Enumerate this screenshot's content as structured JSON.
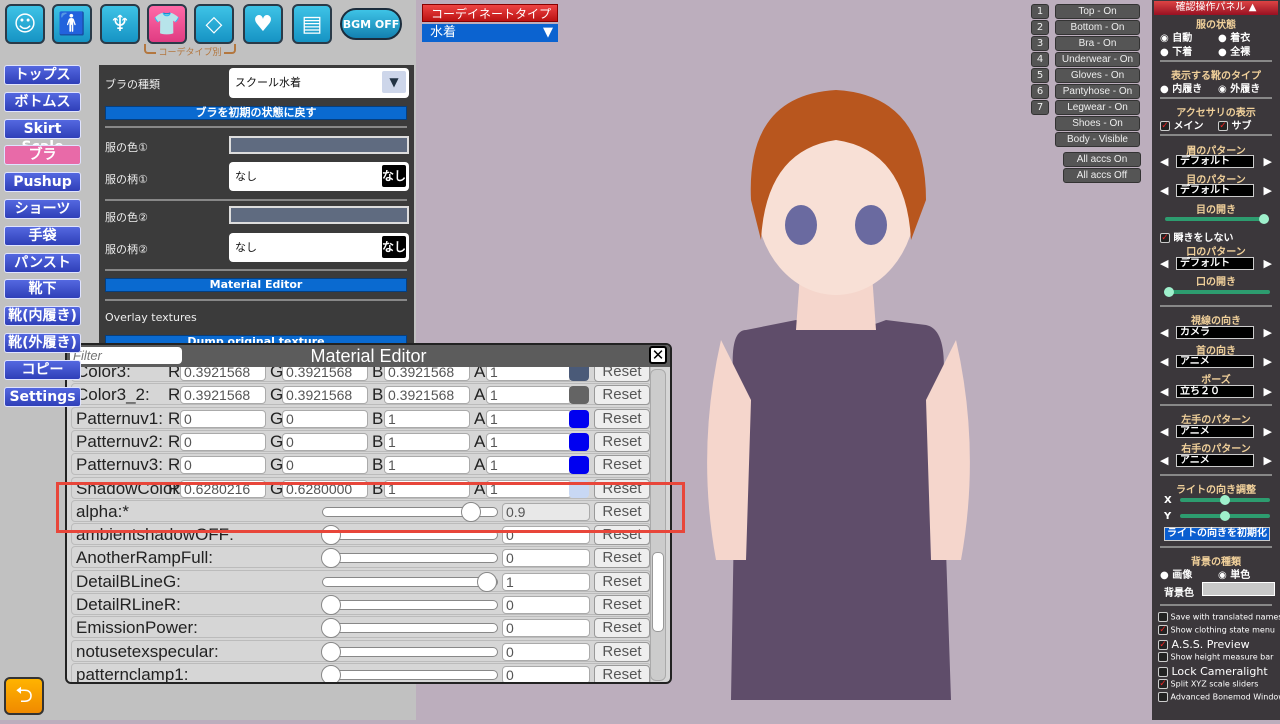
{
  "top_icons": [
    {
      "name": "face-icon",
      "glyph": "☺"
    },
    {
      "name": "body-icon",
      "glyph": "🚹"
    },
    {
      "name": "hair-icon",
      "glyph": "♆"
    },
    {
      "name": "clothes-icon",
      "glyph": "👕"
    },
    {
      "name": "accessory-diamond-icon",
      "glyph": "◇"
    },
    {
      "name": "heart-icon",
      "glyph": "♥"
    },
    {
      "name": "document-icon",
      "glyph": "▤"
    }
  ],
  "bgm_label": "BGM OFF",
  "coord_group_label": "コーデタイプ別",
  "nav": [
    "トップス",
    "ボトムス",
    "Skirt Scale",
    "ブラ",
    "Pushup",
    "ショーツ",
    "手袋",
    "パンスト",
    "靴下",
    "靴(内履き)",
    "靴(外履き)",
    "コピー",
    "Settings"
  ],
  "nav_active": 3,
  "panel": {
    "type_label": "ブラの種類",
    "type_value": "スクール水着",
    "reset_label": "ブラを初期の状態に戻す",
    "color1_label": "服の色①",
    "pattern1_label": "服の柄①",
    "pattern1_value": "なし",
    "pattern1_thumb": "なし",
    "color2_label": "服の色②",
    "pattern2_label": "服の柄②",
    "pattern2_value": "なし",
    "pattern2_thumb": "なし",
    "material_editor_label": "Material Editor",
    "overlay_label": "Overlay textures",
    "dump_label": "Dump original texture",
    "color_value": "#5f6b80"
  },
  "material_editor": {
    "title": "Material Editor",
    "filter_placeholder": "Filter",
    "reset_label": "Reset",
    "color_rows": [
      {
        "name": "Color3:",
        "r": "0.3921568",
        "g": "0.3921568",
        "b": "0.3921568",
        "a": "1",
        "swatch": "#4a5a78"
      },
      {
        "name": "Color3_2:",
        "r": "0.3921568",
        "g": "0.3921568",
        "b": "0.3921568",
        "a": "1",
        "swatch": "#646464"
      },
      {
        "name": "Patternuv1:",
        "r": "0",
        "g": "0",
        "b": "1",
        "a": "1",
        "swatch": "#0000f0"
      },
      {
        "name": "Patternuv2:",
        "r": "0",
        "g": "0",
        "b": "1",
        "a": "1",
        "swatch": "#0000f0"
      },
      {
        "name": "Patternuv3:",
        "r": "0",
        "g": "0",
        "b": "1",
        "a": "1",
        "swatch": "#0000f0"
      },
      {
        "name": "ShadowColor:",
        "r": "0.6280216",
        "g": "0.6280000",
        "b": "1",
        "a": "1",
        "swatch": "#c8d8f4"
      }
    ],
    "float_rows": [
      {
        "name": "alpha:*",
        "value": "0.9",
        "slider": 0.9
      },
      {
        "name": "ambientshadowOFF:",
        "value": "0",
        "slider": 0
      },
      {
        "name": "AnotherRampFull:",
        "value": "0",
        "slider": 0
      },
      {
        "name": "DetailBLineG:",
        "value": "1",
        "slider": 1
      },
      {
        "name": "DetailRLineR:",
        "value": "0",
        "slider": 0
      },
      {
        "name": "EmissionPower:",
        "value": "0",
        "slider": 0
      },
      {
        "name": "notusetexspecular:",
        "value": "0",
        "slider": 0
      },
      {
        "name": "patternclamp1:",
        "value": "0",
        "slider": 0
      }
    ]
  },
  "coordinate": {
    "label": "コーデイネートタイプ",
    "value": "水着"
  },
  "clothing_toggles": [
    {
      "num": "1",
      "label": "Top - On"
    },
    {
      "num": "2",
      "label": "Bottom - On"
    },
    {
      "num": "3",
      "label": "Bra - On"
    },
    {
      "num": "4",
      "label": "Underwear - On"
    },
    {
      "num": "5",
      "label": "Gloves - On"
    },
    {
      "num": "6",
      "label": "Pantyhose - On"
    },
    {
      "num": "7",
      "label": "Legwear - On"
    },
    {
      "num": "",
      "label": "Shoes - On"
    },
    {
      "num": "",
      "label": "Body - Visible"
    }
  ],
  "accs": [
    "All accs On",
    "All accs Off"
  ],
  "right_panel": {
    "title": "確認操作パネル ▲",
    "clothes_state": "服の状態",
    "clothes_opts": [
      "自動",
      "着衣",
      "下着",
      "全裸"
    ],
    "shoe_type": "表示する靴のタイプ",
    "shoe_opts": [
      "内履き",
      "外履き"
    ],
    "acc_display": "アクセサリの表示",
    "acc_opts": [
      "メイン",
      "サブ"
    ],
    "eyebrow": "眉のパターン",
    "eyebrow_value": "デフォルト",
    "eye": "目のパターン",
    "eye_value": "デフォルト",
    "eye_open": "目の開き",
    "eye_open_value": 1.0,
    "no_blink": "瞬きをしない",
    "mouth": "口のパターン",
    "mouth_value": "デフォルト",
    "mouth_open": "口の開き",
    "mouth_open_value": 0.0,
    "gaze": "視線の向き",
    "gaze_value": "カメラ",
    "neck": "首の向き",
    "neck_value": "アニメ",
    "pose": "ポーズ",
    "pose_value": "立ち２０",
    "lhand": "左手のパターン",
    "lhand_value": "アニメ",
    "rhand": "右手のパターン",
    "rhand_value": "アニメ",
    "light": "ライトの向き調整",
    "light_x_label": "X",
    "light_y_label": "Y",
    "light_x": 0.5,
    "light_y": 0.5,
    "light_reset": "ライトの向きを初期化",
    "bg_type": "背景の種類",
    "bg_opts": [
      "画像",
      "単色"
    ],
    "bg_color_label": "背景色",
    "options": [
      {
        "label": "Save with translated names",
        "checked": false
      },
      {
        "label": "Show clothing state menu",
        "checked": true
      },
      {
        "label": "A.S.S. Preview",
        "checked": true
      },
      {
        "label": "Show height measure bar",
        "checked": false
      },
      {
        "label": "Lock Cameralight",
        "checked": false
      },
      {
        "label": "Split XYZ scale sliders",
        "checked": true
      },
      {
        "label": "Advanced Bonemod Window",
        "checked": false
      }
    ]
  }
}
